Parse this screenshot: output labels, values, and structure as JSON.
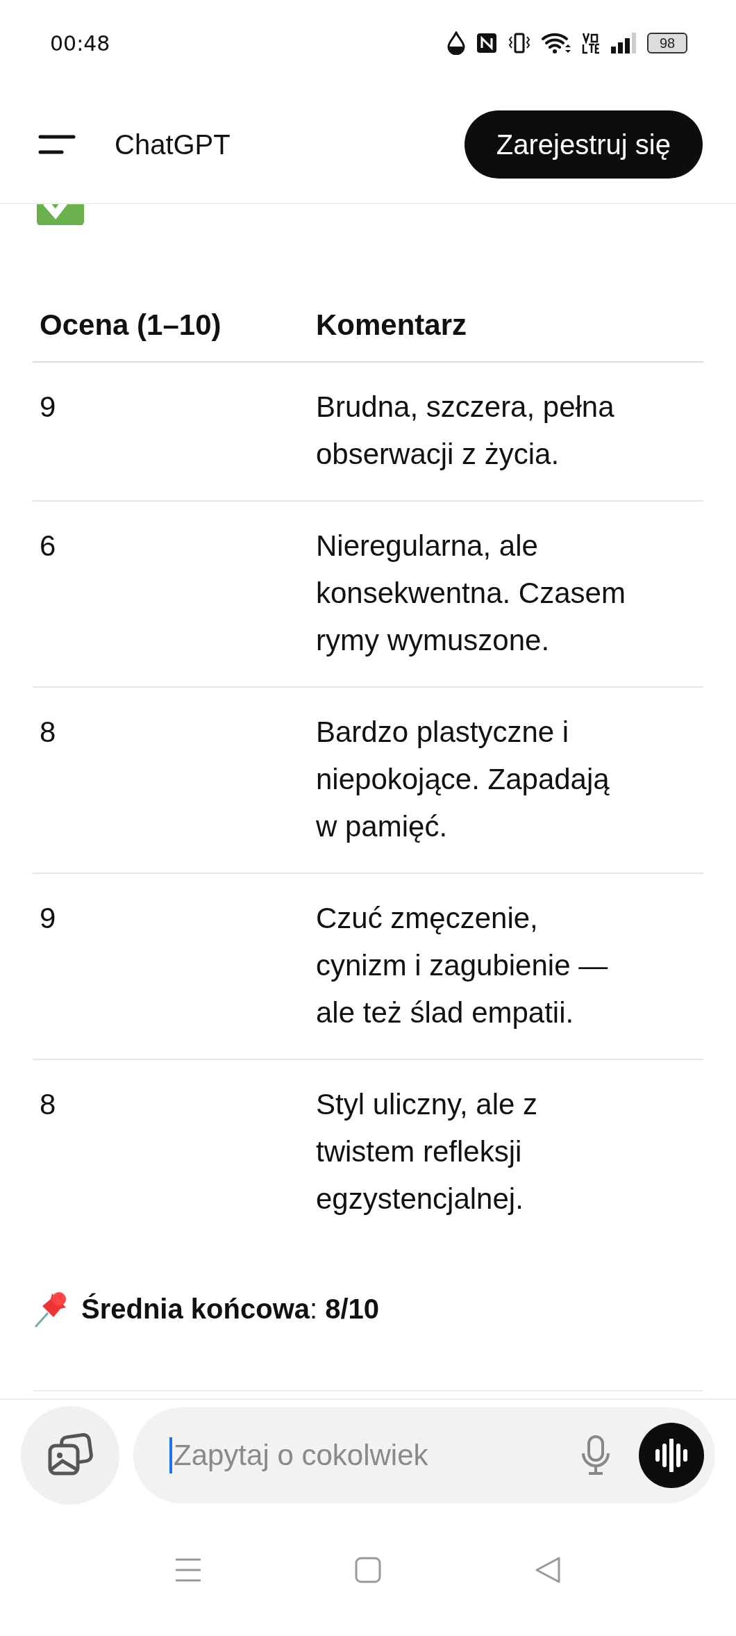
{
  "status_bar": {
    "time": "00:48",
    "battery": "98"
  },
  "header": {
    "title": "ChatGPT",
    "signup_button": "Zarejestruj się"
  },
  "table": {
    "columns": [
      "Ocena (1–10)",
      "Komentarz"
    ],
    "rows": [
      {
        "cells": [
          "9",
          "Brudna, szczera, pełna obserwacji z życia."
        ]
      },
      {
        "cells": [
          "6",
          "Nieregularna, ale konsekwentna. Czasem rymy wymuszone."
        ]
      },
      {
        "cells": [
          "8",
          "Bardzo plastyczne i niepokojące. Zapadają w pamięć."
        ]
      },
      {
        "cells": [
          "9",
          "Czuć zmęczenie, cynizm i zagubienie — ale też ślad empatii."
        ]
      },
      {
        "cells": [
          "8",
          "Styl uliczny, ale z twistem refleksji egzystencjalnej."
        ]
      }
    ]
  },
  "summary": "**Średnia końcowa**: **8/10**",
  "composer": {
    "placeholder": "Zapytaj o cokolwiek"
  }
}
